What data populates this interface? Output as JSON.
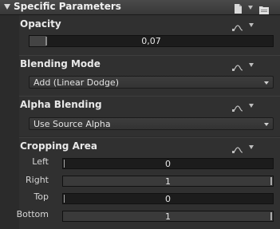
{
  "panel": {
    "title": "Specific Parameters"
  },
  "opacity": {
    "title": "Opacity",
    "value": "0,07",
    "fraction": 0.07
  },
  "blending_mode": {
    "title": "Blending Mode",
    "selected": "Add (Linear Dodge)"
  },
  "alpha_blending": {
    "title": "Alpha Blending",
    "selected": "Use Source Alpha"
  },
  "cropping_area": {
    "title": "Cropping Area",
    "fields": [
      {
        "label": "Left",
        "value": "0"
      },
      {
        "label": "Right",
        "value": "1"
      },
      {
        "label": "Top",
        "value": "0"
      },
      {
        "label": "Bottom",
        "value": "1"
      }
    ]
  },
  "icons": {
    "collapse": "collapse-triangle-icon",
    "page": "page-icon",
    "folder": "folder-icon",
    "keyframe": "keyframe-curve-icon",
    "menu": "chevron-down-icon"
  }
}
